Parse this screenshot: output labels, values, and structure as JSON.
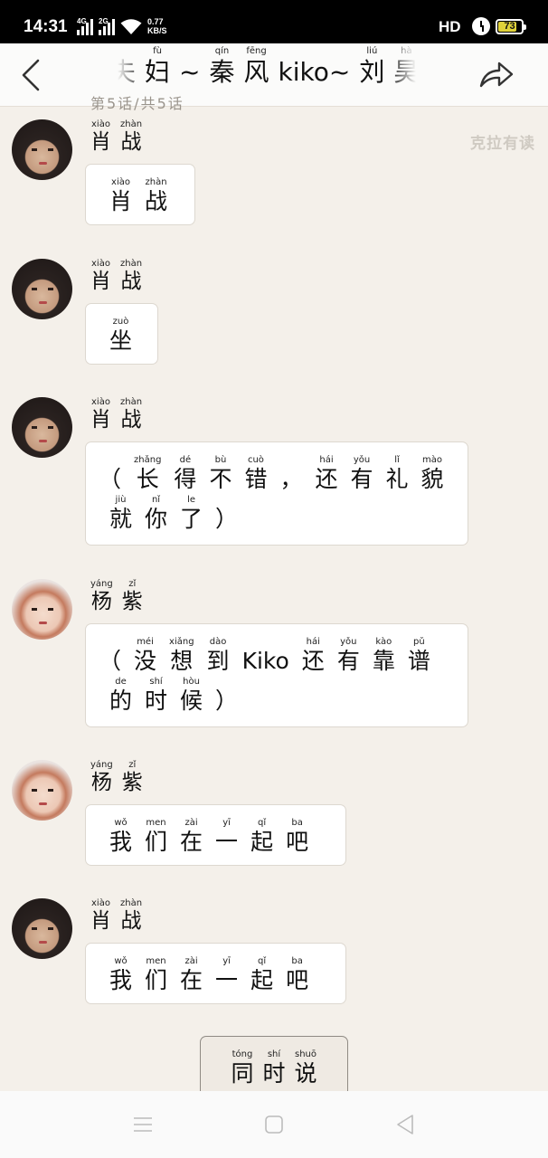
{
  "status_bar": {
    "time": "14:31",
    "net1": "4G",
    "net2": "2G",
    "speed_value": "0.77",
    "speed_unit": "KB/S",
    "hd_label": "HD",
    "battery_level": "73",
    "battery_fraction": 0.73,
    "icons": [
      "signal-icon",
      "wifi-icon",
      "alarm-icon",
      "battery-icon"
    ]
  },
  "header": {
    "title_chars": [
      {
        "py": "",
        "hz": "夫"
      },
      {
        "py": "fù",
        "hz": "妇"
      },
      {
        "py": "",
        "hz": "~"
      },
      {
        "py": "qín",
        "hz": "秦"
      },
      {
        "py": "fēng",
        "hz": "风"
      },
      {
        "py": "",
        "hz": "kiko~"
      },
      {
        "py": "liú",
        "hz": "刘"
      },
      {
        "py": "hà",
        "hz": "昊"
      }
    ],
    "subtitle": "第5话/共5话",
    "back_icon": "back-arrow-icon",
    "share_icon": "share-icon"
  },
  "watermark": "克拉有读",
  "messages": [
    {
      "speaker": [
        {
          "py": "xiào",
          "hz": "肖"
        },
        {
          "py": "zhàn",
          "hz": "战"
        }
      ],
      "avatar": "male",
      "lines": [
        [
          {
            "py": "xiào",
            "hz": "肖"
          },
          {
            "py": "zhàn",
            "hz": "战"
          }
        ]
      ]
    },
    {
      "speaker": [
        {
          "py": "xiào",
          "hz": "肖"
        },
        {
          "py": "zhàn",
          "hz": "战"
        }
      ],
      "avatar": "male",
      "lines": [
        [
          {
            "py": "zuò",
            "hz": "坐"
          }
        ]
      ]
    },
    {
      "speaker": [
        {
          "py": "xiào",
          "hz": "肖"
        },
        {
          "py": "zhàn",
          "hz": "战"
        }
      ],
      "avatar": "male",
      "lines": [
        [
          {
            "py": "",
            "hz": "（"
          },
          {
            "py": "zhǎng",
            "hz": "长"
          },
          {
            "py": "dé",
            "hz": "得"
          },
          {
            "py": "bù",
            "hz": "不"
          },
          {
            "py": "cuò",
            "hz": "错"
          },
          {
            "py": "",
            "hz": "，"
          },
          {
            "py": "hái",
            "hz": "还"
          },
          {
            "py": "yǒu",
            "hz": "有"
          },
          {
            "py": "lǐ",
            "hz": "礼"
          },
          {
            "py": "mào",
            "hz": "貌"
          }
        ],
        [
          {
            "py": "jiù",
            "hz": "就"
          },
          {
            "py": "nǐ",
            "hz": "你"
          },
          {
            "py": "le",
            "hz": "了"
          },
          {
            "py": "",
            "hz": "）"
          }
        ]
      ]
    },
    {
      "speaker": [
        {
          "py": "yáng",
          "hz": "杨"
        },
        {
          "py": "zǐ",
          "hz": "紫"
        }
      ],
      "avatar": "female",
      "lines": [
        [
          {
            "py": "",
            "hz": "（"
          },
          {
            "py": "méi",
            "hz": "没"
          },
          {
            "py": "xiǎng",
            "hz": "想"
          },
          {
            "py": "dào",
            "hz": "到"
          },
          {
            "py": "",
            "hz": "Kiko"
          },
          {
            "py": "hái",
            "hz": "还"
          },
          {
            "py": "yǒu",
            "hz": "有"
          },
          {
            "py": "kào",
            "hz": "靠"
          },
          {
            "py": "pǔ",
            "hz": "谱"
          }
        ],
        [
          {
            "py": "de",
            "hz": "的"
          },
          {
            "py": "shí",
            "hz": "时"
          },
          {
            "py": "hòu",
            "hz": "候"
          },
          {
            "py": "",
            "hz": "）"
          }
        ]
      ]
    },
    {
      "speaker": [
        {
          "py": "yáng",
          "hz": "杨"
        },
        {
          "py": "zǐ",
          "hz": "紫"
        }
      ],
      "avatar": "female",
      "lines": [
        [
          {
            "py": "wǒ",
            "hz": "我"
          },
          {
            "py": "men",
            "hz": "们"
          },
          {
            "py": "zài",
            "hz": "在"
          },
          {
            "py": "yī",
            "hz": "一"
          },
          {
            "py": "qǐ",
            "hz": "起"
          },
          {
            "py": "ba",
            "hz": "吧"
          }
        ]
      ]
    },
    {
      "speaker": [
        {
          "py": "xiào",
          "hz": "肖"
        },
        {
          "py": "zhàn",
          "hz": "战"
        }
      ],
      "avatar": "male",
      "lines": [
        [
          {
            "py": "wǒ",
            "hz": "我"
          },
          {
            "py": "men",
            "hz": "们"
          },
          {
            "py": "zài",
            "hz": "在"
          },
          {
            "py": "yī",
            "hz": "一"
          },
          {
            "py": "qǐ",
            "hz": "起"
          },
          {
            "py": "ba",
            "hz": "吧"
          }
        ]
      ]
    }
  ],
  "option_button": [
    {
      "py": "tóng",
      "hz": "同"
    },
    {
      "py": "shí",
      "hz": "时"
    },
    {
      "py": "shuō",
      "hz": "说"
    }
  ],
  "nav_bar": {
    "icons": [
      "menu-icon",
      "home-icon",
      "back-icon"
    ]
  }
}
